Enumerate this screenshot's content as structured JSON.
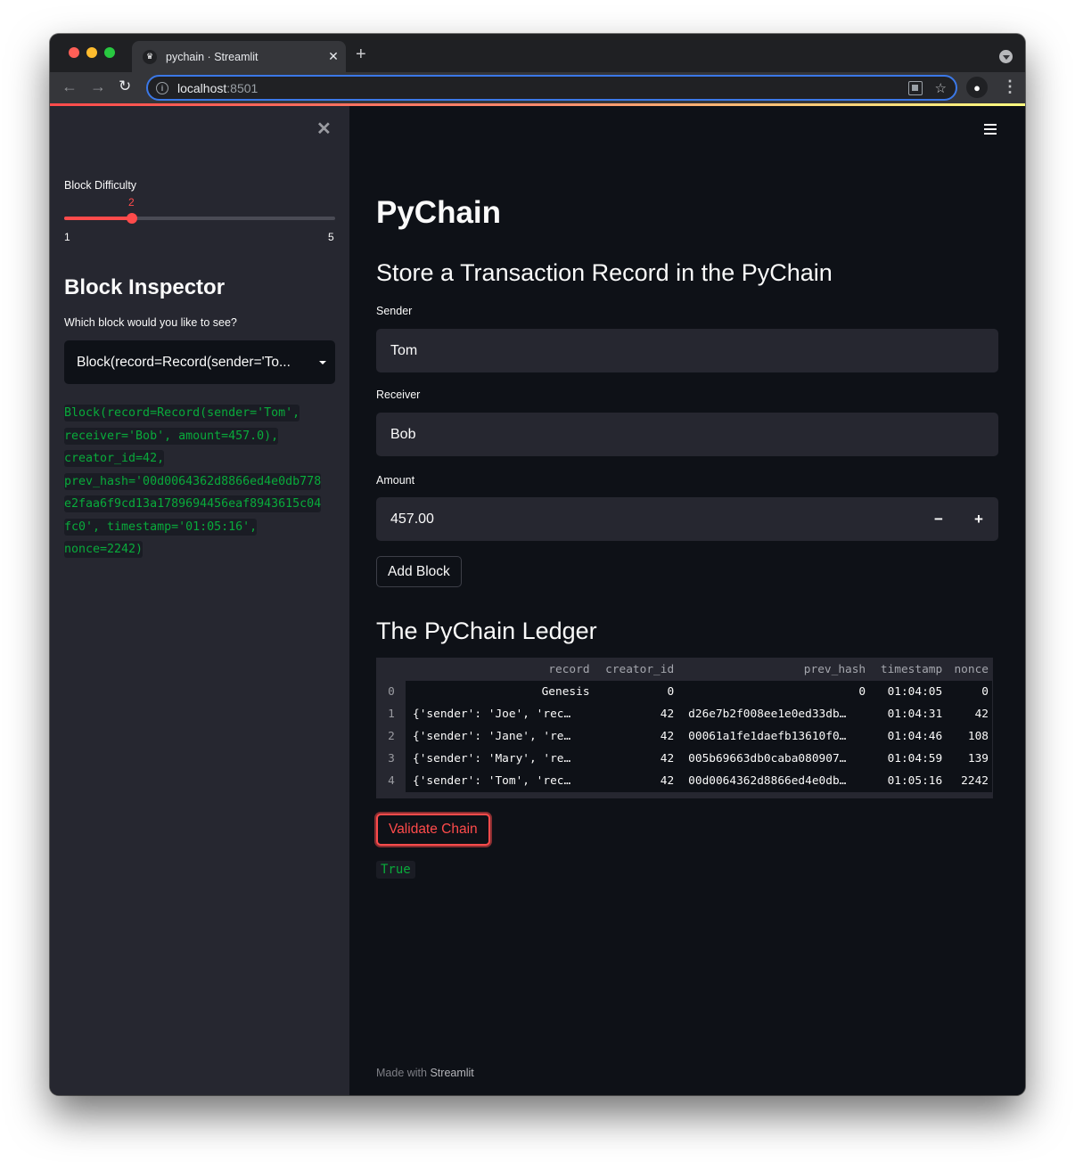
{
  "browser": {
    "tab_title": "pychain · Streamlit",
    "url_host": "localhost",
    "url_port": ":8501",
    "icons": [
      "back-arrow-icon",
      "forward-arrow-icon",
      "reload-icon",
      "info-icon",
      "qr-code-icon",
      "star-icon",
      "profile-icon",
      "menu-kebab-icon"
    ]
  },
  "sidebar": {
    "slider": {
      "label": "Block Difficulty",
      "value": "2",
      "min": "1",
      "max": "5",
      "fraction": 0.25
    },
    "inspector_title": "Block Inspector",
    "select_label": "Which block would you like to see?",
    "select_value": "Block(record=Record(sender='To...",
    "block_output": [
      "Block(record=Record(sender='Tom',",
      "receiver='Bob', amount=457.0),",
      "creator_id=42,",
      "prev_hash='00d0064362d8866ed4e0db778",
      "e2faa6f9cd13a1789694456eaf8943615c04",
      "fc0', timestamp='01:05:16',",
      "nonce=2242)"
    ]
  },
  "main": {
    "title": "PyChain",
    "form_title": "Store a Transaction Record in the PyChain",
    "sender_label": "Sender",
    "sender_value": "Tom",
    "receiver_label": "Receiver",
    "receiver_value": "Bob",
    "amount_label": "Amount",
    "amount_value": "457.00",
    "minus_label": "−",
    "plus_label": "+",
    "add_block_label": "Add Block",
    "ledger_title": "The PyChain Ledger",
    "ledger": {
      "columns": [
        "",
        "record",
        "creator_id",
        "prev_hash",
        "timestamp",
        "nonce"
      ],
      "rows": [
        {
          "index": "0",
          "record": "Genesis",
          "creator_id": "0",
          "prev_hash": "0",
          "timestamp": "01:04:05",
          "nonce": "0"
        },
        {
          "index": "1",
          "record": "{'sender': 'Joe', 'rec…",
          "creator_id": "42",
          "prev_hash": "d26e7b2f008ee1e0ed33db…",
          "timestamp": "01:04:31",
          "nonce": "42"
        },
        {
          "index": "2",
          "record": "{'sender': 'Jane', 're…",
          "creator_id": "42",
          "prev_hash": "00061a1fe1daefb13610f0…",
          "timestamp": "01:04:46",
          "nonce": "108"
        },
        {
          "index": "3",
          "record": "{'sender': 'Mary', 're…",
          "creator_id": "42",
          "prev_hash": "005b69663db0caba080907…",
          "timestamp": "01:04:59",
          "nonce": "139"
        },
        {
          "index": "4",
          "record": "{'sender': 'Tom', 'rec…",
          "creator_id": "42",
          "prev_hash": "00d0064362d8866ed4e0db…",
          "timestamp": "01:05:16",
          "nonce": "2242"
        }
      ]
    },
    "validate_label": "Validate Chain",
    "validate_result": "True"
  },
  "footer": {
    "prefix": "Made with",
    "brand": "Streamlit"
  },
  "colors": {
    "primary": "#ff4b4b",
    "success_text": "#09ab3b",
    "background": "#0e1117",
    "secondary_background": "#262730",
    "text": "#fafafa"
  }
}
